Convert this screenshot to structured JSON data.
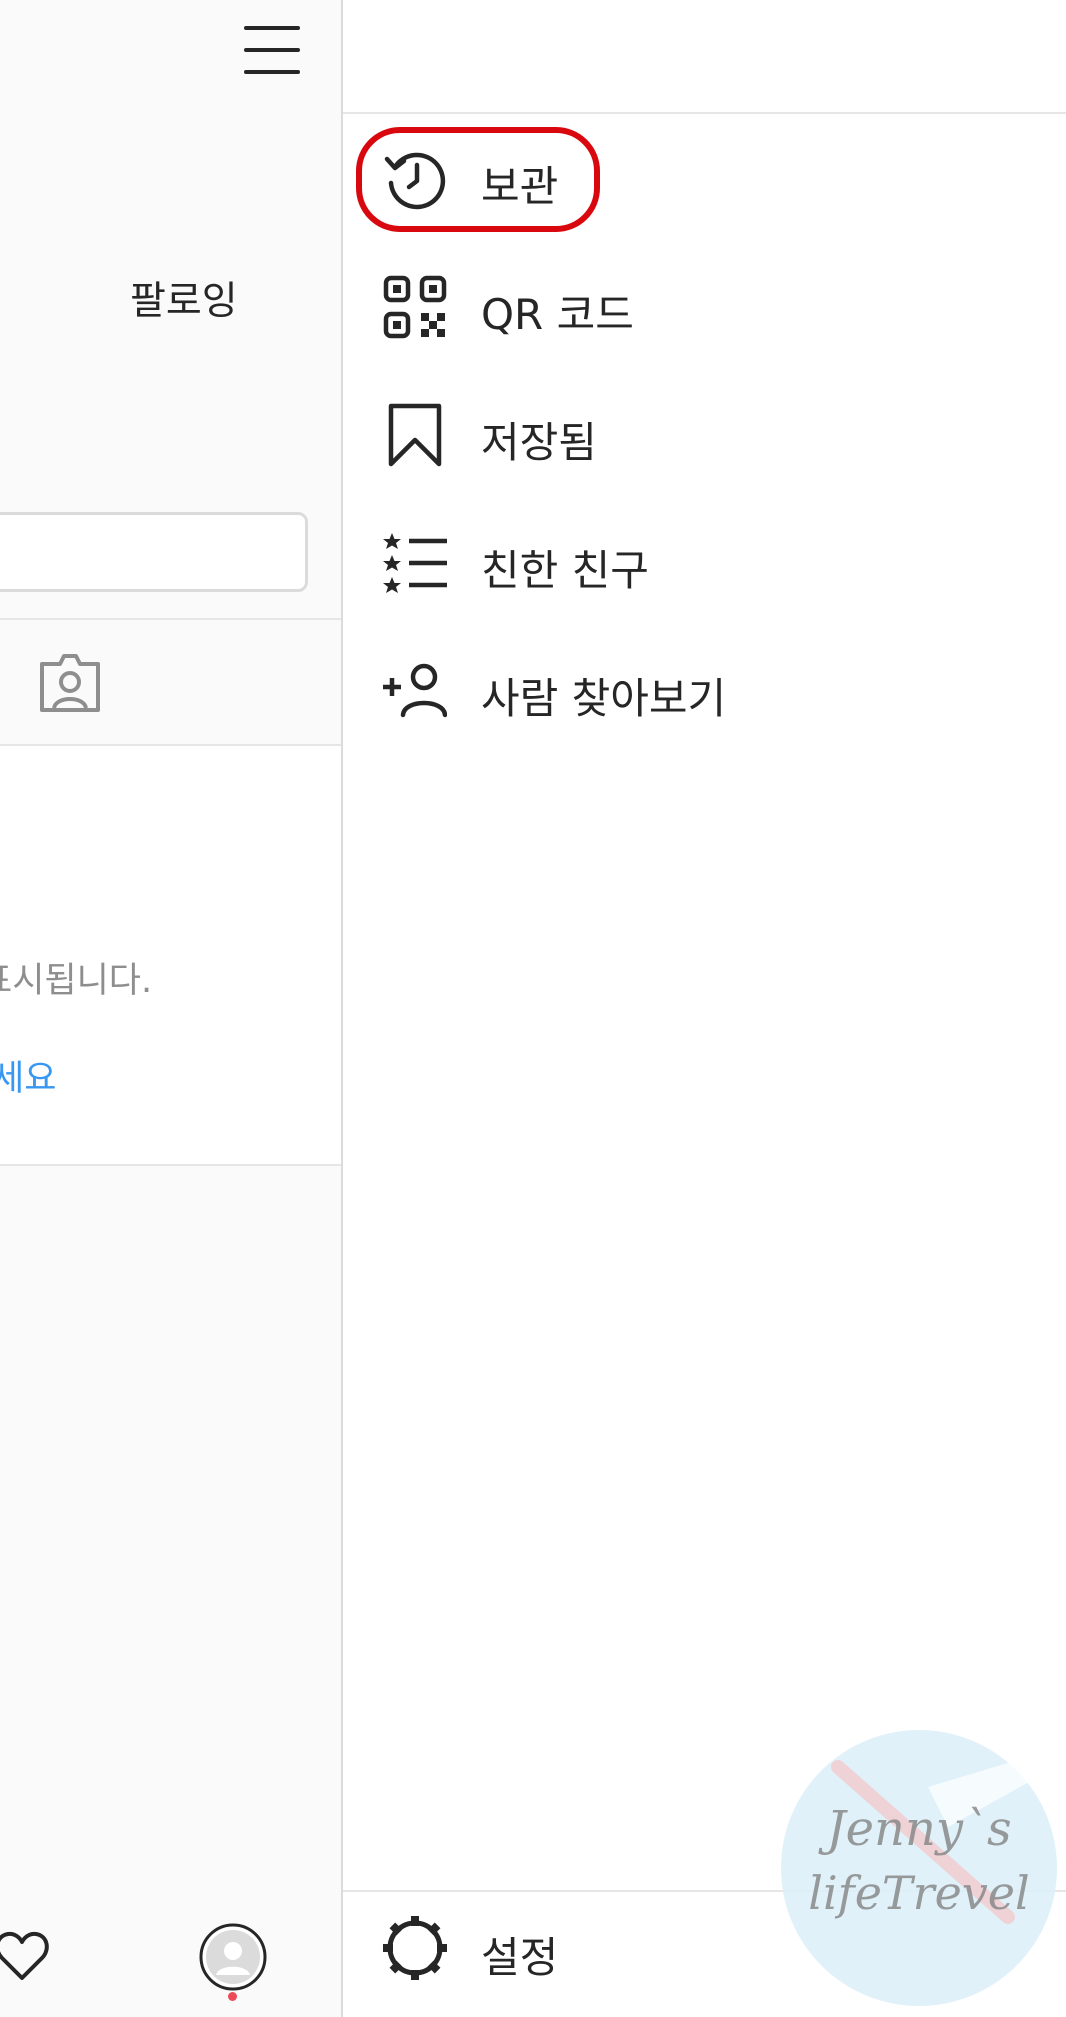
{
  "profile_panel": {
    "following_label": "팔로잉",
    "empty_state_text": "표시됩니다.",
    "empty_state_link": "세요"
  },
  "drawer": {
    "menu": [
      {
        "label": "보관",
        "icon": "archive-history-icon"
      },
      {
        "label": "QR 코드",
        "icon": "qr-code-icon"
      },
      {
        "label": "저장됨",
        "icon": "bookmark-icon"
      },
      {
        "label": "친한 친구",
        "icon": "close-friends-list-icon"
      },
      {
        "label": "사람 찾아보기",
        "icon": "add-person-icon"
      }
    ],
    "settings_label": "설정",
    "settings_icon": "gear-icon",
    "highlighted_item": "보관"
  },
  "watermark": {
    "line1": "Jenny`s",
    "line2": "lifeTrevel"
  },
  "colors": {
    "highlight": "#d9080f",
    "link": "#3897f0",
    "notification": "#ed4956"
  }
}
